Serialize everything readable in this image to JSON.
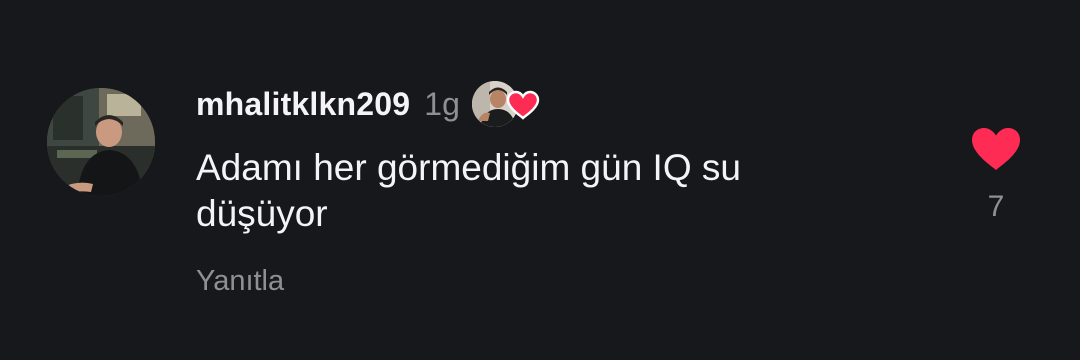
{
  "comment": {
    "username": "mhalitklkn209",
    "time": "1g",
    "text": "Adamı her görmediğim gün IQ su düşüyor",
    "reply_label": "Yanıtla",
    "like_count": "7"
  },
  "colors": {
    "background": "#17181b",
    "primary_text": "#f4f4f6",
    "secondary_text": "#8f9096",
    "heart": "#fe2c55"
  },
  "icons": {
    "creator_liked": "heart-icon",
    "like": "heart-icon"
  }
}
